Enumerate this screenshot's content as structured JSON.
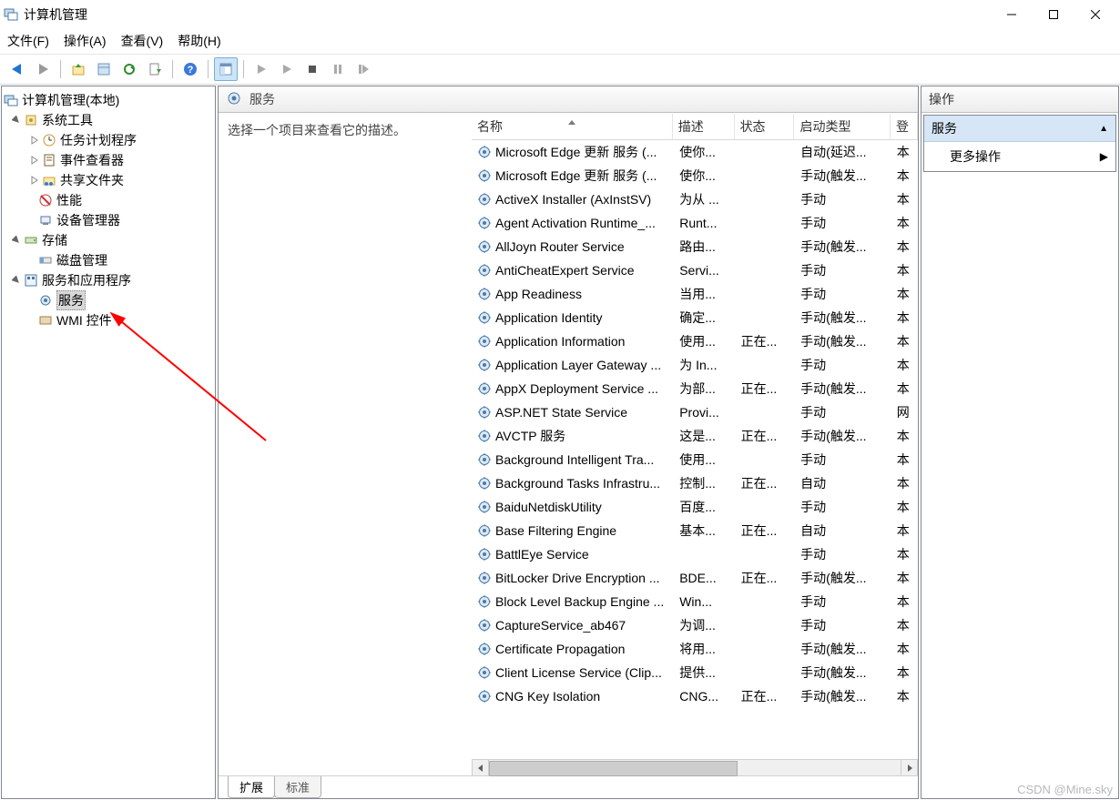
{
  "window": {
    "title": "计算机管理"
  },
  "menu": {
    "file": "文件(F)",
    "action": "操作(A)",
    "view": "查看(V)",
    "help": "帮助(H)"
  },
  "tree": {
    "root": "计算机管理(本地)",
    "system_tools": "系统工具",
    "task_scheduler": "任务计划程序",
    "event_viewer": "事件查看器",
    "shared_folders": "共享文件夹",
    "performance": "性能",
    "device_manager": "设备管理器",
    "storage": "存储",
    "disk_management": "磁盘管理",
    "services_apps": "服务和应用程序",
    "services": "服务",
    "wmi": "WMI 控件"
  },
  "center": {
    "header": "服务",
    "desc_placeholder": "选择一个项目来查看它的描述。",
    "columns": {
      "name": "名称",
      "description": "描述",
      "status": "状态",
      "startup": "启动类型",
      "logon": "登"
    },
    "tabs": {
      "extended": "扩展",
      "standard": "标准"
    }
  },
  "col_widths": {
    "name": 220,
    "description": 58,
    "status": 56,
    "startup": 98,
    "logon": 18
  },
  "services": [
    {
      "name": "Microsoft Edge 更新 服务 (...",
      "desc": "使你...",
      "status": "",
      "startup": "自动(延迟...",
      "logon": "本"
    },
    {
      "name": "Microsoft Edge 更新 服务 (...",
      "desc": "使你...",
      "status": "",
      "startup": "手动(触发...",
      "logon": "本"
    },
    {
      "name": "ActiveX Installer (AxInstSV)",
      "desc": "为从 ...",
      "status": "",
      "startup": "手动",
      "logon": "本"
    },
    {
      "name": "Agent Activation Runtime_...",
      "desc": "Runt...",
      "status": "",
      "startup": "手动",
      "logon": "本"
    },
    {
      "name": "AllJoyn Router Service",
      "desc": "路由...",
      "status": "",
      "startup": "手动(触发...",
      "logon": "本"
    },
    {
      "name": "AntiCheatExpert Service",
      "desc": "Servi...",
      "status": "",
      "startup": "手动",
      "logon": "本"
    },
    {
      "name": "App Readiness",
      "desc": "当用...",
      "status": "",
      "startup": "手动",
      "logon": "本"
    },
    {
      "name": "Application Identity",
      "desc": "确定...",
      "status": "",
      "startup": "手动(触发...",
      "logon": "本"
    },
    {
      "name": "Application Information",
      "desc": "使用...",
      "status": "正在...",
      "startup": "手动(触发...",
      "logon": "本"
    },
    {
      "name": "Application Layer Gateway ...",
      "desc": "为 In...",
      "status": "",
      "startup": "手动",
      "logon": "本"
    },
    {
      "name": "AppX Deployment Service ...",
      "desc": "为部...",
      "status": "正在...",
      "startup": "手动(触发...",
      "logon": "本"
    },
    {
      "name": "ASP.NET State Service",
      "desc": "Provi...",
      "status": "",
      "startup": "手动",
      "logon": "网"
    },
    {
      "name": "AVCTP 服务",
      "desc": "这是...",
      "status": "正在...",
      "startup": "手动(触发...",
      "logon": "本"
    },
    {
      "name": "Background Intelligent Tra...",
      "desc": "使用...",
      "status": "",
      "startup": "手动",
      "logon": "本"
    },
    {
      "name": "Background Tasks Infrastru...",
      "desc": "控制...",
      "status": "正在...",
      "startup": "自动",
      "logon": "本"
    },
    {
      "name": "BaiduNetdiskUtility",
      "desc": "百度...",
      "status": "",
      "startup": "手动",
      "logon": "本"
    },
    {
      "name": "Base Filtering Engine",
      "desc": "基本...",
      "status": "正在...",
      "startup": "自动",
      "logon": "本"
    },
    {
      "name": "BattlEye Service",
      "desc": "",
      "status": "",
      "startup": "手动",
      "logon": "本"
    },
    {
      "name": "BitLocker Drive Encryption ...",
      "desc": "BDE...",
      "status": "正在...",
      "startup": "手动(触发...",
      "logon": "本"
    },
    {
      "name": "Block Level Backup Engine ...",
      "desc": "Win...",
      "status": "",
      "startup": "手动",
      "logon": "本"
    },
    {
      "name": "CaptureService_ab467",
      "desc": "为调...",
      "status": "",
      "startup": "手动",
      "logon": "本"
    },
    {
      "name": "Certificate Propagation",
      "desc": "将用...",
      "status": "",
      "startup": "手动(触发...",
      "logon": "本"
    },
    {
      "name": "Client License Service (Clip...",
      "desc": "提供...",
      "status": "",
      "startup": "手动(触发...",
      "logon": "本"
    },
    {
      "name": "CNG Key Isolation",
      "desc": "CNG...",
      "status": "正在...",
      "startup": "手动(触发...",
      "logon": "本"
    }
  ],
  "actions": {
    "header": "操作",
    "section_title": "服务",
    "more_ops": "更多操作"
  },
  "watermark": "CSDN @Mine.sky"
}
